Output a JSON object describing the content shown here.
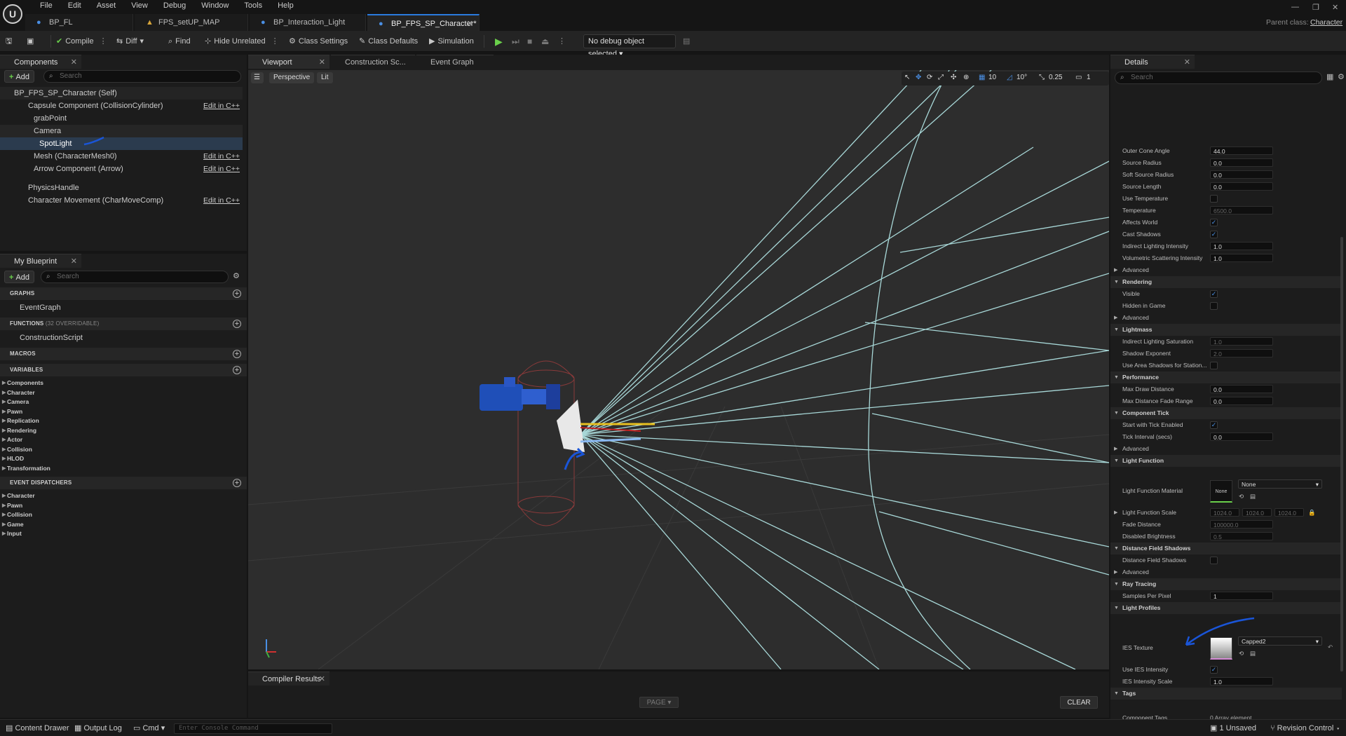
{
  "menu": [
    "File",
    "Edit",
    "Asset",
    "View",
    "Debug",
    "Window",
    "Tools",
    "Help"
  ],
  "tabs": [
    {
      "label": "BP_FL",
      "active": false
    },
    {
      "label": "FPS_setUP_MAP",
      "active": false
    },
    {
      "label": "BP_Interaction_Light",
      "active": false
    },
    {
      "label": "BP_FPS_SP_Character*",
      "active": true
    }
  ],
  "parent_class": {
    "label": "Parent class:",
    "value": "Character"
  },
  "toolbar": {
    "compile": "Compile",
    "diff": "Diff",
    "find": "Find",
    "hide_unrelated": "Hide Unrelated",
    "class_settings": "Class Settings",
    "class_defaults": "Class Defaults",
    "simulation": "Simulation",
    "debug_object": "No debug object selected"
  },
  "components": {
    "tab": "Components",
    "add": "Add",
    "search_placeholder": "Search",
    "items": [
      {
        "label": "BP_FPS_SP_Character (Self)",
        "edit": ""
      },
      {
        "label": "Capsule Component (CollisionCylinder)",
        "edit": "Edit in C++"
      },
      {
        "label": "grabPoint",
        "edit": ""
      },
      {
        "label": "Camera",
        "edit": ""
      },
      {
        "label": "SpotLight",
        "edit": ""
      },
      {
        "label": "Mesh (CharacterMesh0)",
        "edit": "Edit in C++"
      },
      {
        "label": "Arrow Component (Arrow)",
        "edit": "Edit in C++"
      },
      {
        "label": "PhysicsHandle",
        "edit": ""
      },
      {
        "label": "Character Movement (CharMoveComp)",
        "edit": "Edit in C++"
      }
    ]
  },
  "blueprint": {
    "tab": "My Blueprint",
    "add": "Add",
    "search_placeholder": "Search",
    "graphs": "GRAPHS",
    "event_graph": "EventGraph",
    "functions": "FUNCTIONS",
    "functions_sub": "(32 OVERRIDABLE)",
    "construction_script": "ConstructionScript",
    "macros": "MACROS",
    "variables": "VARIABLES",
    "variable_items": [
      "Components",
      "Character",
      "Camera",
      "Pawn",
      "Replication",
      "Rendering",
      "Actor",
      "Collision",
      "HLOD",
      "Transformation"
    ],
    "event_dispatchers": "EVENT DISPATCHERS",
    "dispatcher_items": [
      "Character",
      "Pawn",
      "Collision",
      "Game",
      "Input"
    ]
  },
  "editor_tabs": [
    "Viewport",
    "Construction Sc...",
    "Event Graph"
  ],
  "viewport": {
    "perspective": "Perspective",
    "lit": "Lit",
    "grid": "10",
    "angle": "10°",
    "scale": "0.25",
    "camera_speed": "1"
  },
  "compiler": {
    "tab": "Compiler Results",
    "page": "PAGE",
    "clear": "CLEAR"
  },
  "details": {
    "tab": "Details",
    "search_placeholder": "Search",
    "rows": [
      {
        "type": "prop",
        "label": "Outer Cone Angle",
        "value": "44.0"
      },
      {
        "type": "prop",
        "label": "Source Radius",
        "value": "0.0"
      },
      {
        "type": "prop",
        "label": "Soft Source Radius",
        "value": "0.0"
      },
      {
        "type": "prop",
        "label": "Source Length",
        "value": "0.0"
      },
      {
        "type": "check",
        "label": "Use Temperature",
        "checked": false
      },
      {
        "type": "prop",
        "label": "Temperature",
        "value": "6500.0",
        "disabled": true
      },
      {
        "type": "check",
        "label": "Affects World",
        "checked": true
      },
      {
        "type": "check",
        "label": "Cast Shadows",
        "checked": true
      },
      {
        "type": "prop",
        "label": "Indirect Lighting Intensity",
        "value": "1.0"
      },
      {
        "type": "prop",
        "label": "Volumetric Scattering Intensity",
        "value": "1.0"
      },
      {
        "type": "sub",
        "label": "Advanced"
      },
      {
        "type": "cat",
        "label": "Rendering"
      },
      {
        "type": "check",
        "label": "Visible",
        "checked": true
      },
      {
        "type": "check",
        "label": "Hidden in Game",
        "checked": false
      },
      {
        "type": "sub",
        "label": "Advanced"
      },
      {
        "type": "cat",
        "label": "Lightmass"
      },
      {
        "type": "prop",
        "label": "Indirect Lighting Saturation",
        "value": "1.0",
        "disabled": true
      },
      {
        "type": "prop",
        "label": "Shadow Exponent",
        "value": "2.0",
        "disabled": true
      },
      {
        "type": "check",
        "label": "Use Area Shadows for Station...",
        "checked": false
      },
      {
        "type": "cat",
        "label": "Performance"
      },
      {
        "type": "prop",
        "label": "Max Draw Distance",
        "value": "0.0"
      },
      {
        "type": "prop",
        "label": "Max Distance Fade Range",
        "value": "0.0"
      },
      {
        "type": "cat",
        "label": "Component Tick"
      },
      {
        "type": "check",
        "label": "Start with Tick Enabled",
        "checked": true
      },
      {
        "type": "prop",
        "label": "Tick Interval (secs)",
        "value": "0.0"
      },
      {
        "type": "sub",
        "label": "Advanced"
      },
      {
        "type": "cat",
        "label": "Light Function"
      }
    ],
    "light_function_material": {
      "label": "Light Function Material",
      "thumb": "None",
      "value": "None"
    },
    "light_function_scale": {
      "label": "Light Function Scale",
      "x": "1024.0",
      "y": "1024.0",
      "z": "1024.0"
    },
    "rows2": [
      {
        "type": "prop",
        "label": "Fade Distance",
        "value": "100000.0",
        "disabled": true
      },
      {
        "type": "prop",
        "label": "Disabled Brightness",
        "value": "0.5",
        "disabled": true
      },
      {
        "type": "cat",
        "label": "Distance Field Shadows"
      },
      {
        "type": "check",
        "label": "Distance Field Shadows",
        "checked": false
      },
      {
        "type": "sub",
        "label": "Advanced"
      },
      {
        "type": "cat",
        "label": "Ray Tracing"
      },
      {
        "type": "prop",
        "label": "Samples Per Pixel",
        "value": "1",
        "wide": true
      },
      {
        "type": "cat",
        "label": "Light Profiles"
      }
    ],
    "ies_texture": {
      "label": "IES Texture",
      "value": "Capped2"
    },
    "rows3": [
      {
        "type": "check",
        "label": "Use IES Intensity",
        "checked": true
      },
      {
        "type": "prop",
        "label": "IES Intensity Scale",
        "value": "1.0",
        "wide": true
      },
      {
        "type": "cat",
        "label": "Tags"
      }
    ],
    "component_tags": {
      "label": "Component Tags",
      "value": "0 Array element"
    }
  },
  "statusbar": {
    "content_drawer": "Content Drawer",
    "output_log": "Output Log",
    "cmd": "Cmd",
    "console_placeholder": "Enter Console Command",
    "unsaved": "1 Unsaved",
    "revision_control": "Revision Control"
  }
}
